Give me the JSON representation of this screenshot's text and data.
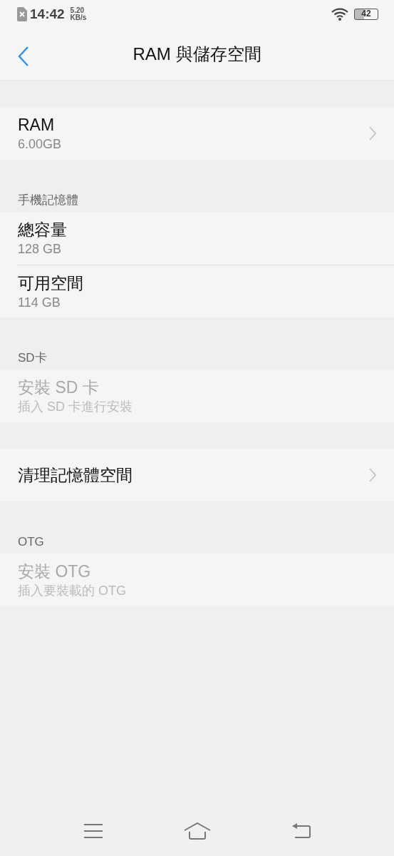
{
  "status_bar": {
    "time": "14:42",
    "speed_value": "5.20",
    "speed_unit": "KB/s",
    "battery": "42"
  },
  "header": {
    "title": "RAM 與儲存空間"
  },
  "sections": [
    {
      "items": [
        {
          "title": "RAM",
          "subtitle": "6.00GB",
          "chevron": true,
          "disabled": false
        }
      ]
    },
    {
      "header": "手機記憶體",
      "items": [
        {
          "title": "總容量",
          "subtitle": "128 GB",
          "chevron": false,
          "disabled": false
        },
        {
          "title": "可用空間",
          "subtitle": "114 GB",
          "chevron": false,
          "disabled": false
        }
      ]
    },
    {
      "header": "SD卡",
      "items": [
        {
          "title": "安裝 SD 卡",
          "subtitle": "插入 SD 卡進行安裝",
          "chevron": false,
          "disabled": true
        }
      ]
    },
    {
      "items": [
        {
          "title": "清理記憶體空間",
          "chevron": true,
          "disabled": false
        }
      ]
    },
    {
      "header": "OTG",
      "items": [
        {
          "title": "安裝 OTG",
          "subtitle": "插入要裝載的 OTG",
          "chevron": false,
          "disabled": true
        }
      ]
    }
  ]
}
